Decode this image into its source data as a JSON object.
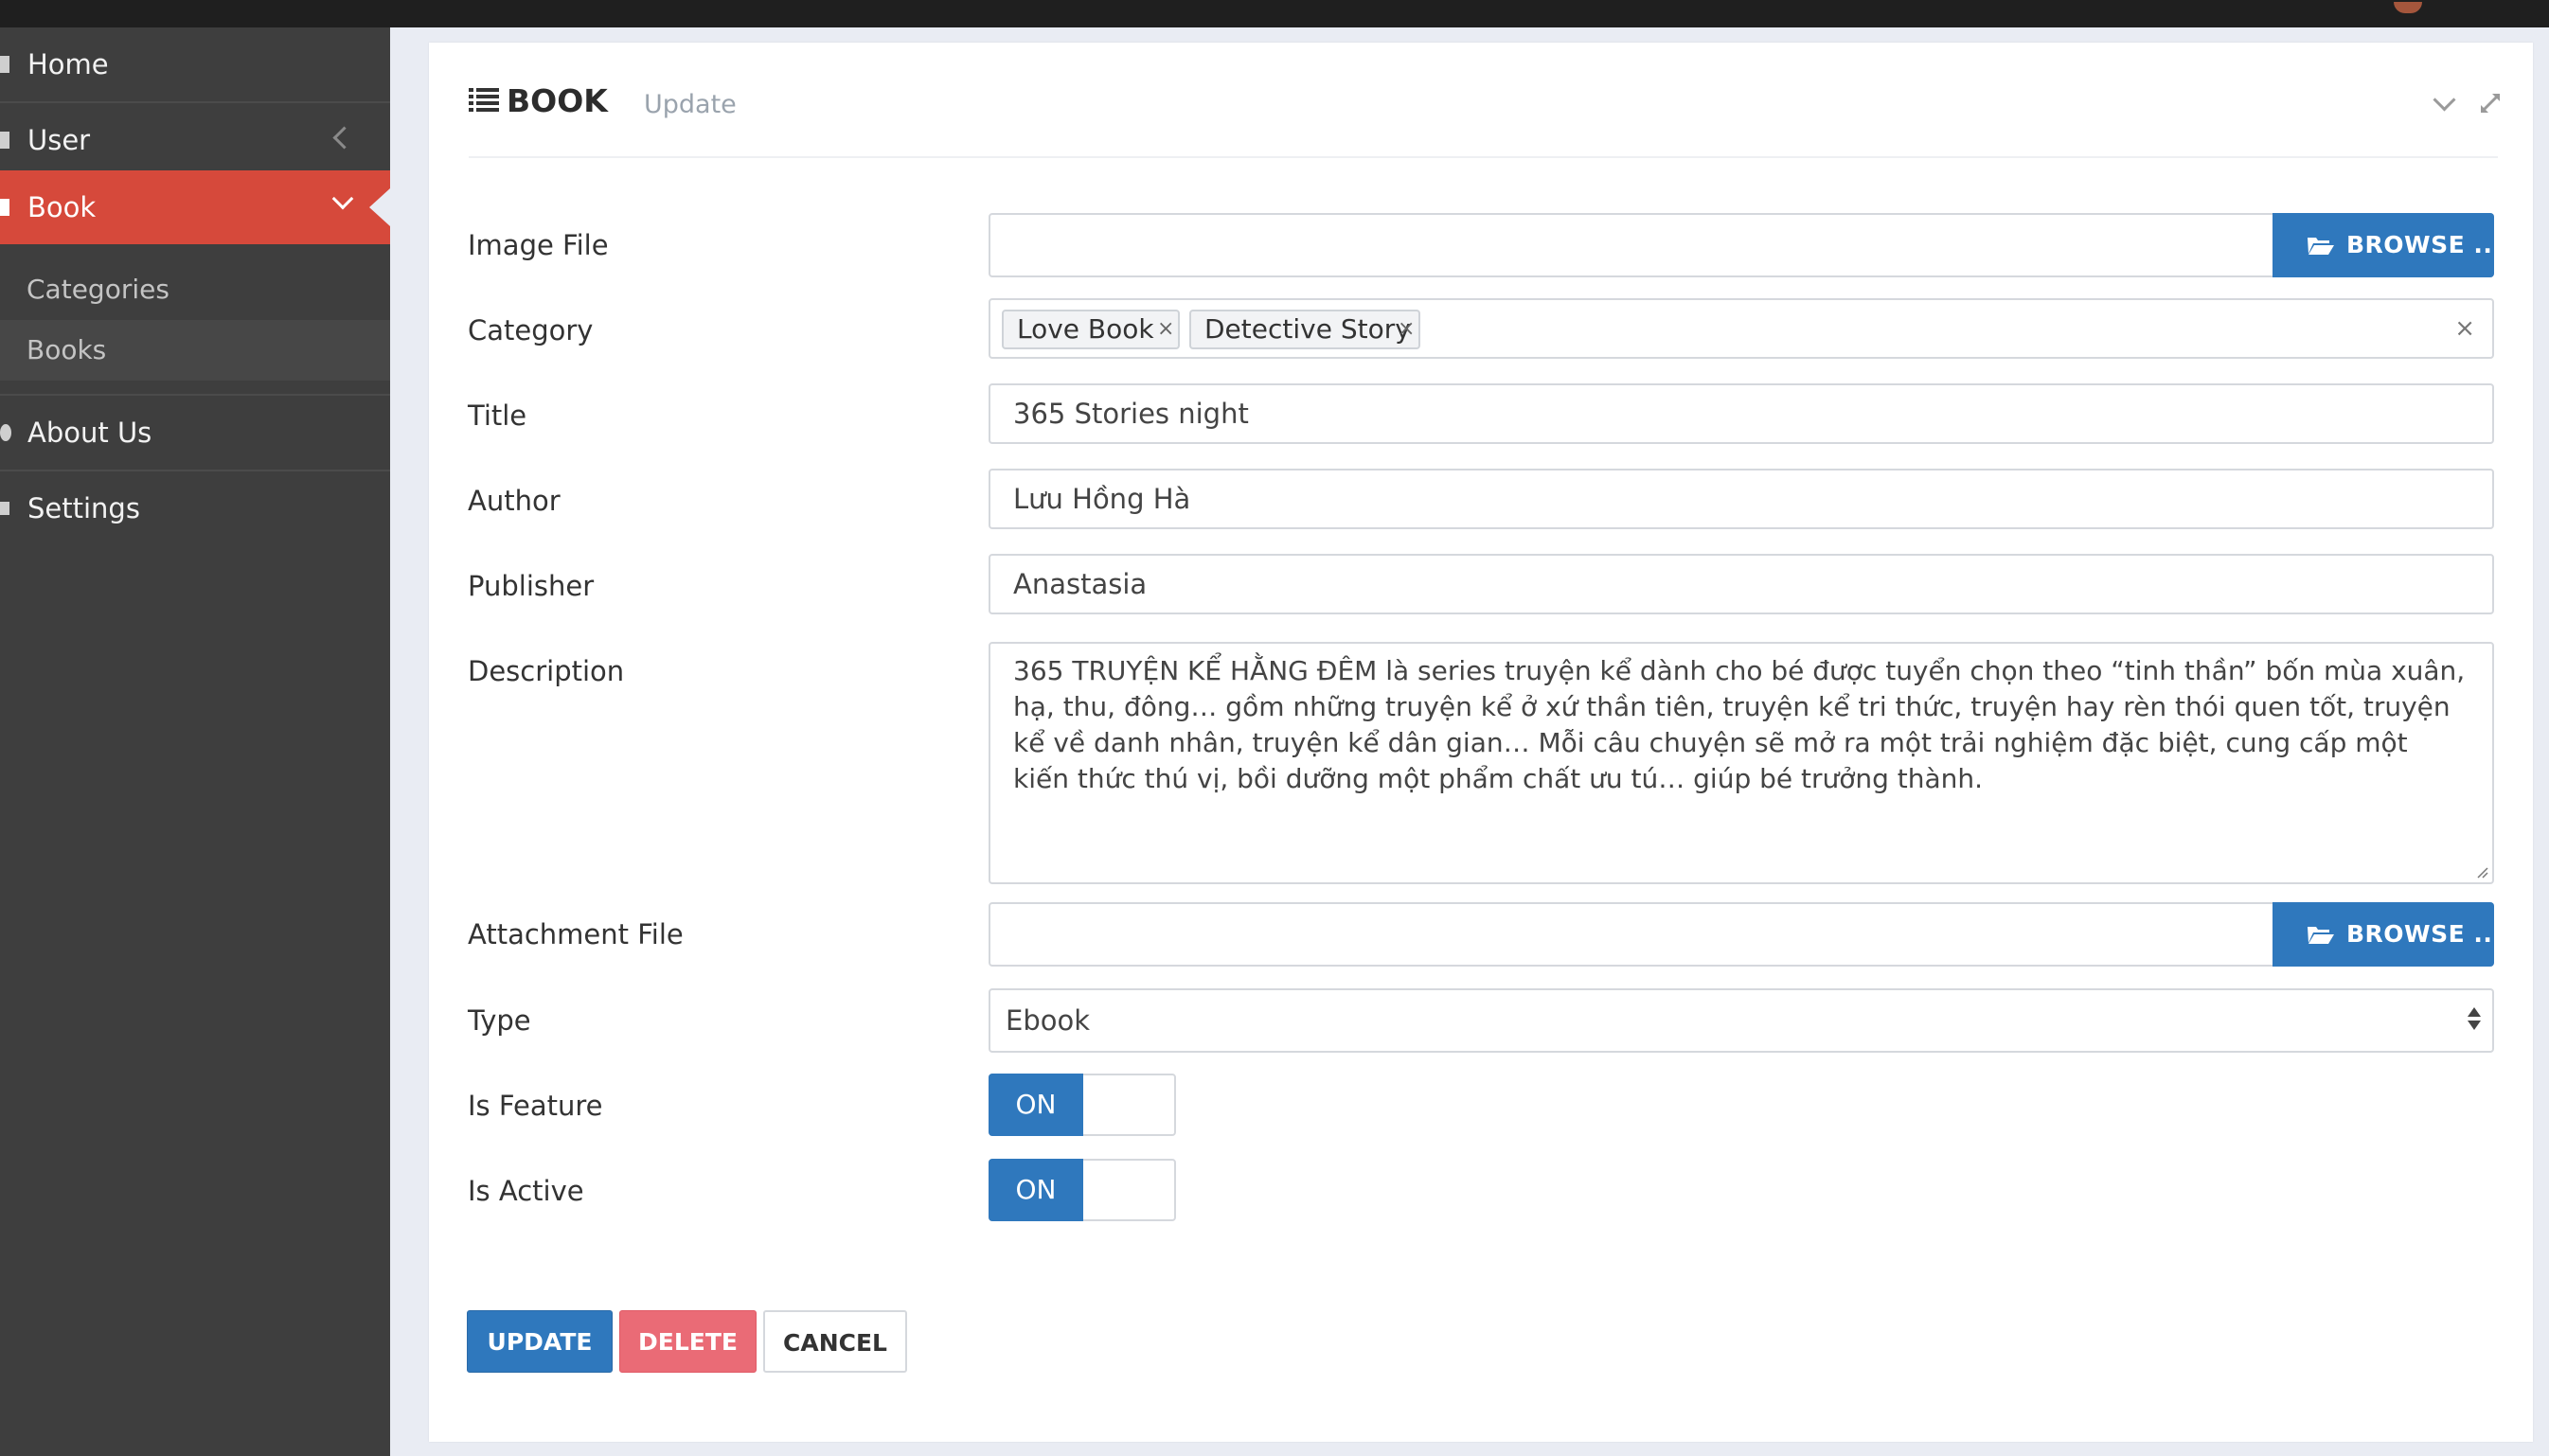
{
  "sidebar": {
    "items": [
      {
        "label": "Home",
        "icon": "home-icon"
      },
      {
        "label": "User",
        "icon": "user-icon"
      },
      {
        "label": "Book",
        "icon": "book-icon",
        "active": true
      },
      {
        "label": "About Us",
        "icon": "info-icon"
      },
      {
        "label": "Settings",
        "icon": "gear-icon"
      }
    ],
    "subitems": [
      {
        "label": "Categories"
      },
      {
        "label": "Books",
        "selected": true
      }
    ]
  },
  "panel": {
    "title": "BOOK",
    "subtitle": "Update"
  },
  "form": {
    "image_file": {
      "label": "Image File",
      "value": "",
      "browse_label": "BROWSE ..."
    },
    "category": {
      "label": "Category",
      "tags": [
        "Love Book",
        "Detective Story"
      ],
      "remove_symbol": "×",
      "clear_symbol": "×"
    },
    "title": {
      "label": "Title",
      "value": "365 Stories night"
    },
    "author": {
      "label": "Author",
      "value": "Lưu Hồng Hà"
    },
    "publisher": {
      "label": "Publisher",
      "value": "Anastasia"
    },
    "description": {
      "label": "Description",
      "value": "365 TRUYỆN KỂ HẰNG ĐÊM là series truyện kể dành cho bé được tuyển chọn theo “tinh thần” bốn mùa xuân, hạ, thu, đông… gồm những truyện kể ở xứ thần tiên, truyện kể tri thức, truyện hay rèn thói quen tốt, truyện kể về danh nhân, truyện kể dân gian… Mỗi câu chuyện sẽ mở ra một trải nghiệm đặc biệt, cung cấp một kiến thức thú vị, bồi dưỡng một phẩm chất ưu tú… giúp bé trưởng thành."
    },
    "attachment_file": {
      "label": "Attachment File",
      "value": "",
      "browse_label": "BROWSE ..."
    },
    "type": {
      "label": "Type",
      "value": "Ebook"
    },
    "is_feature": {
      "label": "Is Feature",
      "state": "ON"
    },
    "is_active": {
      "label": "Is Active",
      "state": "ON"
    }
  },
  "actions": {
    "update_label": "UPDATE",
    "delete_label": "DELETE",
    "cancel_label": "CANCEL"
  },
  "colors": {
    "sidebar_bg": "#3e3e3e",
    "active_nav": "#d6493b",
    "primary": "#2f78bd",
    "danger": "#ea6b76"
  }
}
